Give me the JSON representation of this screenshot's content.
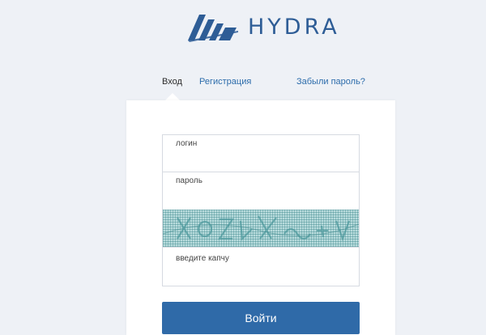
{
  "brand": {
    "name": "HYDRA",
    "logo_icon": "hydra-stripes-logo-icon",
    "color": "#2e5d96"
  },
  "tabs": {
    "login": "Вход",
    "register": "Регистрация",
    "forgot": "Забыли пароль?"
  },
  "form": {
    "login_label": "логин",
    "password_label": "пароль",
    "captcha_label": "введите капчу",
    "submit_label": "Войти"
  },
  "colors": {
    "background": "#eef1f6",
    "link": "#2c6cab",
    "button": "#2f6aa8",
    "captcha": "#b9dcdd"
  }
}
